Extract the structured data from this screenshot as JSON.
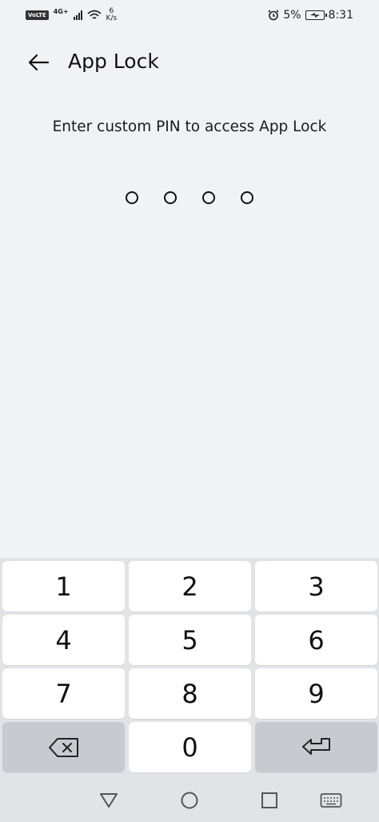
{
  "status_bar": {
    "volte": "VoLTE",
    "network": "4G+",
    "speed_value": "6",
    "speed_unit": "K/s",
    "battery": "5%",
    "time": "8:31"
  },
  "header": {
    "title": "App Lock"
  },
  "prompt": "Enter custom PIN to access App Lock",
  "pin_length": 4,
  "keypad": {
    "keys": [
      "1",
      "2",
      "3",
      "4",
      "5",
      "6",
      "7",
      "8",
      "9",
      "0"
    ]
  },
  "icons": {
    "back": "arrow-left-icon",
    "backspace": "backspace-icon",
    "enter": "enter-icon",
    "nav_back": "triangle-back-icon",
    "nav_home": "circle-home-icon",
    "nav_recents": "square-recents-icon",
    "nav_keyboard": "keyboard-icon"
  }
}
